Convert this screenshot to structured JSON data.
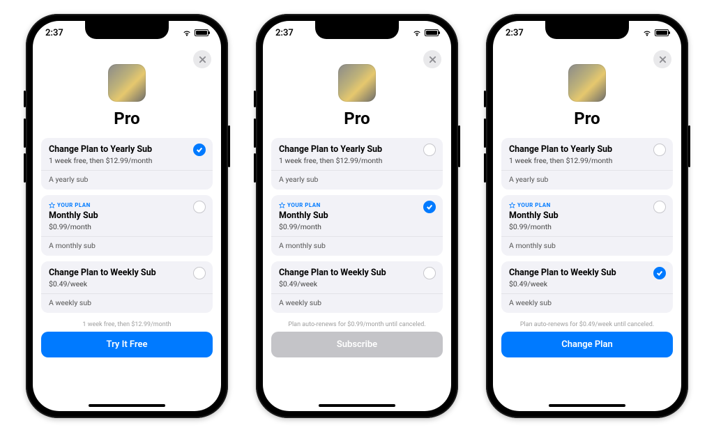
{
  "status": {
    "time": "2:37"
  },
  "hero": {
    "title": "Pro"
  },
  "badge_label": "YOUR PLAN",
  "plans": {
    "yearly": {
      "title": "Change Plan to Yearly Sub",
      "price": "1 week free, then $12.99/month",
      "desc": "A yearly sub"
    },
    "monthly": {
      "title": "Monthly Sub",
      "price": "$0.99/month",
      "desc": "A monthly sub"
    },
    "weekly": {
      "title": "Change Plan to Weekly Sub",
      "price": "$0.49/week",
      "desc": "A weekly sub"
    }
  },
  "phones": [
    {
      "selected": "yearly",
      "footnote": "1 week free, then $12.99/month",
      "cta_label": "Try It Free",
      "cta_style": "blue"
    },
    {
      "selected": "monthly",
      "footnote": "Plan auto-renews for $0.99/month until canceled.",
      "cta_label": "Subscribe",
      "cta_style": "grey"
    },
    {
      "selected": "weekly",
      "footnote": "Plan auto-renews for $0.49/week until canceled.",
      "cta_label": "Change Plan",
      "cta_style": "blue"
    }
  ]
}
